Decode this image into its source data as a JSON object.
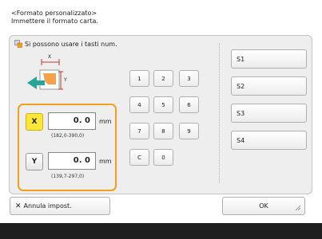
{
  "header": {
    "line1": "<Formato personalizzato>",
    "line2": "Immettere il formato carta."
  },
  "hint": {
    "text": "Si possono usare i tasti num.",
    "icon": "keypad-hand-icon"
  },
  "diagram": {
    "x_label": "X",
    "y_label": "Y"
  },
  "x_input": {
    "label": "X",
    "value": "0. 0",
    "unit": "mm",
    "range": "(182,0-390,0)"
  },
  "y_input": {
    "label": "Y",
    "value": "0. 0",
    "unit": "mm",
    "range": "(139,7-297,0)"
  },
  "keypad": {
    "keys": [
      "1",
      "2",
      "3",
      "4",
      "5",
      "6",
      "7",
      "8",
      "9",
      "C",
      "0"
    ]
  },
  "saved_sizes": [
    "S1",
    "S2",
    "S3",
    "S4"
  ],
  "buttons": {
    "cancel": "Annula impost.",
    "ok": "OK"
  },
  "colors": {
    "accent": "#f0a01e",
    "active_axis": "#fce63a",
    "panel": "#eeeeee",
    "bottom_bar": "#1f1f1f"
  }
}
